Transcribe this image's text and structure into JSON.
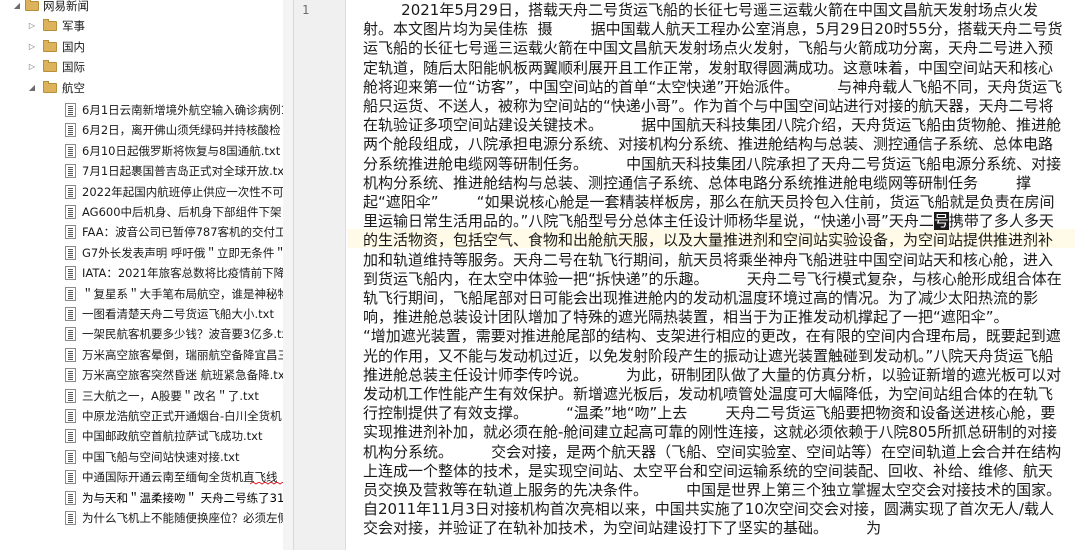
{
  "tree": {
    "root": "网易新闻",
    "folders": [
      "军事",
      "国内",
      "国际",
      "航空"
    ],
    "files": [
      "6月1日云南新增境外航空输入确诊病例1",
      "6月2日，离开佛山须凭绿码并持核酸检",
      "6月10日起俄罗斯将恢复与8国通航.txt",
      "7月1日起裹国普吉岛正式对全球开放.txt",
      "2022年起国内航班停止供应一次性不可",
      "AG600中后机身、后机身下部组件下架",
      "FAA：波音公司已暂停787客机的交付工",
      "G7外长发表声明 呼吁俄＂立即无条件＂",
      "IATA：2021年旅客总数将比疫情前下降",
      "＂复星系＂大手笔布局航空，谁是神秘物",
      "一图看清楚天舟二号货运飞船大小.txt",
      "一架民航客机要多少钱？波音要3亿多.tx",
      "万米高空旅客晕倒，瑞丽航空备降宜昌三",
      "万米高空旅客突然昏迷 航班紧急备降.tx",
      "三大航之一，A股要＂改名＂了.txt",
      "中原龙浩航空正式开通烟台-白川全货机",
      "中国邮政航空首航拉萨试飞成功.txt",
      "中国飞船与空间站快速对接.txt",
      "中通国际开通云南至缅甸全货机直飞线",
      "为与天和＂温柔接吻＂ 天舟二号练了31",
      "为什么飞机上不能随便换座位？必须左侧"
    ],
    "selected_index": 19
  },
  "editor": {
    "line_number": "1",
    "before_caret": "        2021年5月29日，搭载天舟二号货运飞船的长征七号遥三运载火箭在中国文昌航天发射场点火发射。本文图片均为吴佳栋  摄        据中国载人航天工程办公室消息，5月29日20时55分，搭载天舟二号货运飞船的长征七号遥三运载火箭在中国文昌航天发射场点火发射，飞船与火箭成功分离，天舟二号进入预定轨道，随后太阳能帆板两翼顺利展开且工作正常，发射取得圆满成功。这意味着，中国空间站天和核心舱将迎来第一位“访客”，中国空间站的首单“太空快递”开始派件。        与神舟载人飞船不同，天舟货运飞船只运货、不送人，被称为空间站的“快递小哥”。作为首个与中国空间站进行对接的航天器，天舟二号将在轨验证多项空间站建设关键技术。        据中国航天科技集团八院介绍，天舟货运飞船由货物舱、推进舱两个舱段组成，八院承担电源分系统、对接机构分系统、推进舱结构与总装、测控通信子系统、总体电路分系统推进舱电缆网等研制任务。        中国航天科技集团八院承担了天舟二号货运飞船电源分系统、对接机构分系统、推进舱结构与总装、测控通信子系统、总体电路分系统推进舱电缆网等研制任务        撑起“遮阳伞”        “如果说核心舱是一套精装样板房，那么在航天员拎包入住前，货运飞船就是负责在房间里运输日常生活用品的。”八院飞船型号分总体主任设计师杨华星说，“快递小哥”天舟二",
    "caret_char": "号",
    "after_caret": "携带了多人多天的生活物资，包括空气、食物和出舱航天服，以及大量推进剂和空间站实验设备，为空间站提供推进剂补加和轨道维持等服务。天舟二号在轨飞行期间，航天员将乘坐神舟飞船进驻中国空间站天和核心舱，进入到货运飞船内，在太空中体验一把“拆快递”的乐趣。        天舟二号飞行模式复杂，与核心舱形成组合体在轨飞行期间，飞船尾部对日可能会出现推进舱内的发动机温度环境过高的情况。为了减少太阳热流的影响，推进舱总装设计团队增加了特殊的遮光隔热装置，相当于为正推发动机撑起了一把“遮阳伞”。        “增加遮光装置，需要对推进舱尾部的结构、支架进行相应的更改，在有限的空间内合理布局，既要起到遮光的作用，又不能与发动机过近，以免发射阶段产生的振动让遮光装置触碰到发动机。”八院天舟货运飞船推进舱总装主任设计师李传吟说。        为此，研制团队做了大量的仿真分析，以验证新增的遮光板可以对发动机工作性能产生有效保护。新增遮光板后，发动机喷管处温度可大幅降低，为空间站组合体的在轨飞行控制提供了有效支撑。        “温柔”地“吻”上去        天舟二号货运飞船要把物资和设备送进核心舱，要实现推进剂补加，就必须在舱-舱间建立起高可靠的刚性连接，这就必须依赖于八院805所抓总研制的对接机构分系统。        交会对接，是两个航天器（飞船、空间实验室、空间站等）在空间轨道上会合并在结构上连成一个整体的技术，是实现空间站、太空平台和空间运输系统的空间装配、回收、补给、维修、航天员交换及营救等在轨道上服务的先决条件。        中国是世界上第三个独立掌握太空交会对接技术的国家。自2011年11月3日对接机构首次亮相以来，中国共实施了10次空间交会对接，圆满实现了首次无人/载人交会对接，并验证了在轨补加技术，为空间站建设打下了坚实的基础。        为"
  },
  "colors": {
    "selected_bg": "#d3d3d3",
    "folder": "#dcb35c",
    "squiggle": "#d9232e"
  }
}
